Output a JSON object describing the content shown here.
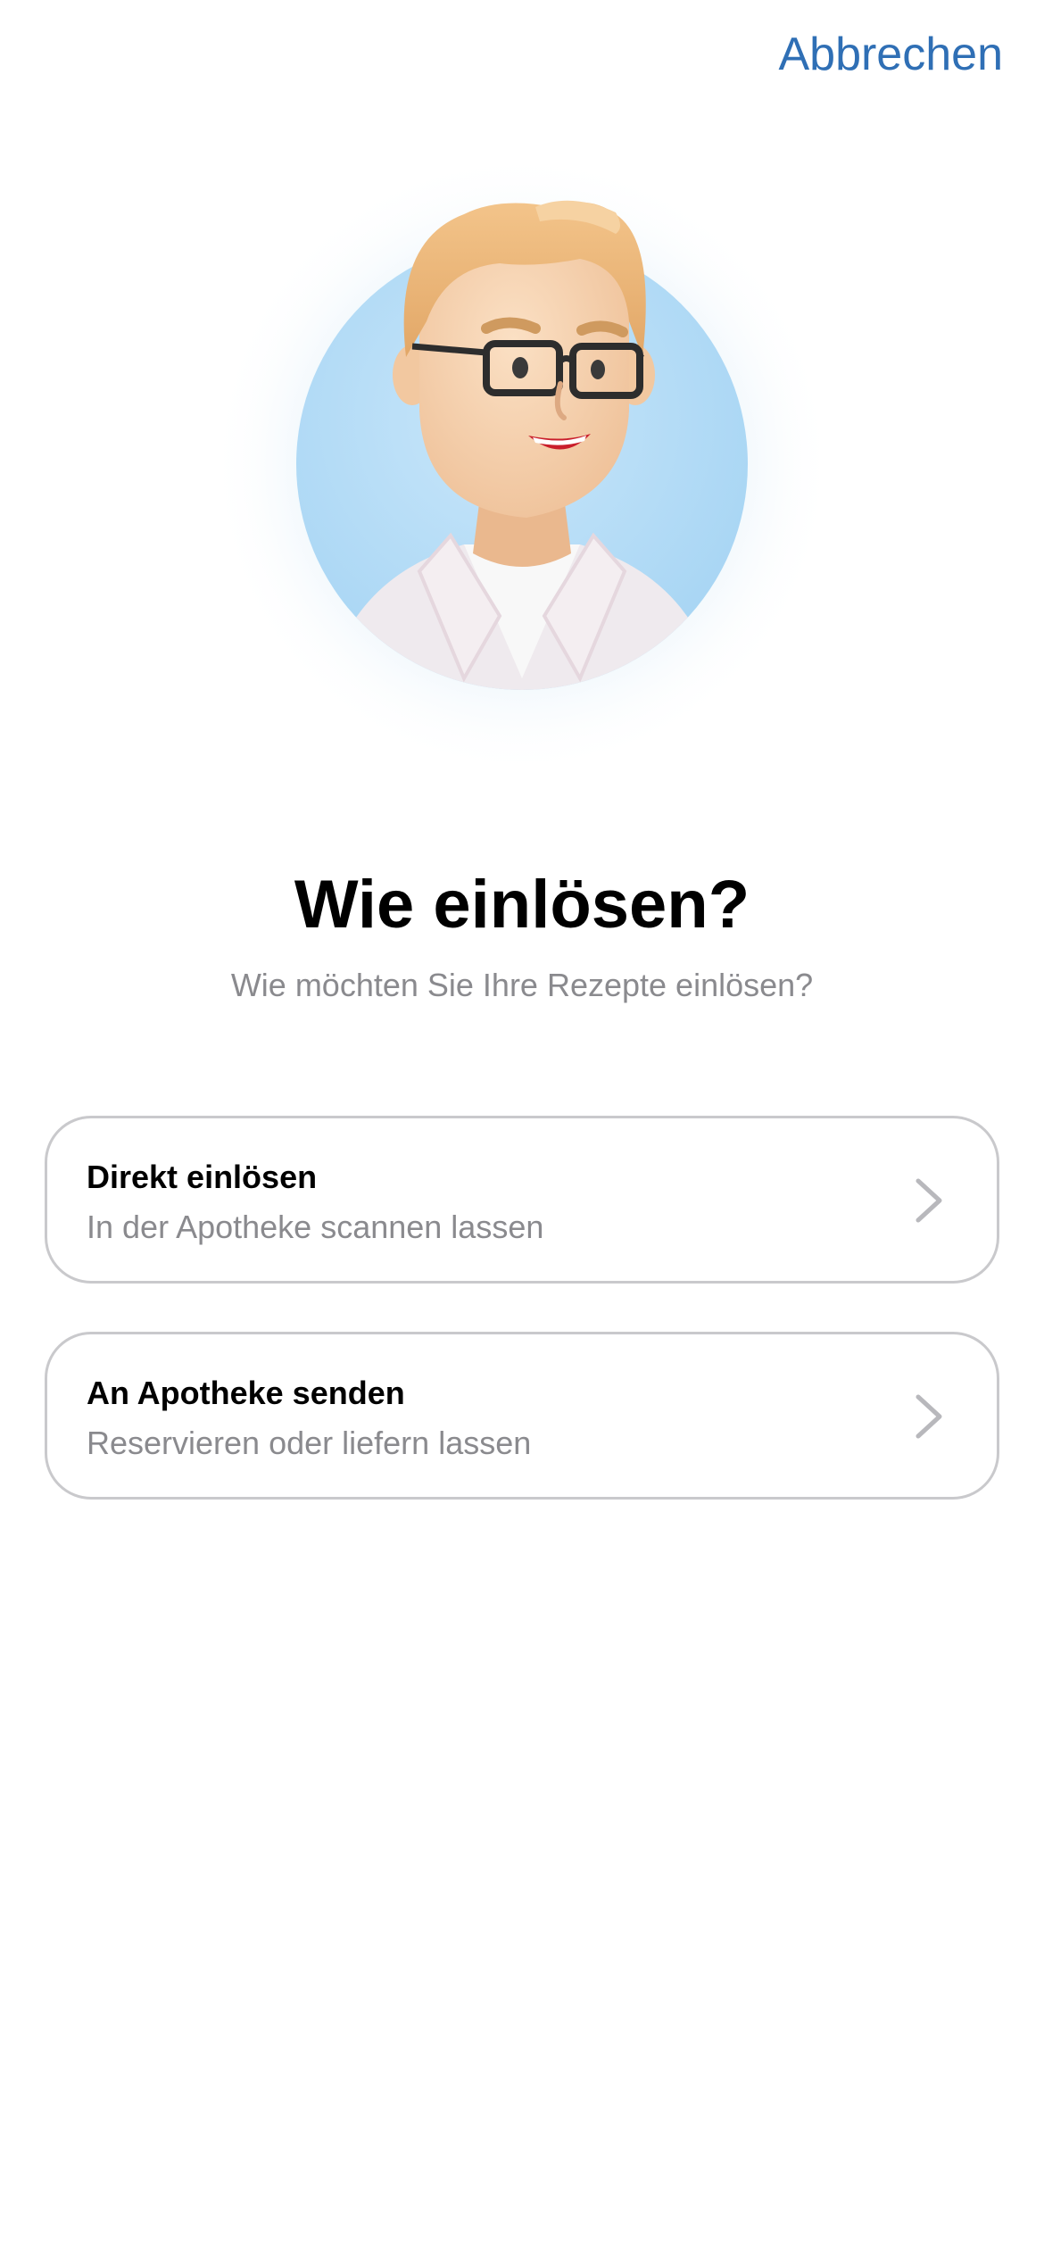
{
  "header": {
    "cancel_label": "Abbrechen"
  },
  "hero": {
    "illustration": "pharmacist-avatar",
    "accent_color": "#bfe0f7"
  },
  "main": {
    "title": "Wie einlösen?",
    "subtitle": "Wie möchten Sie Ihre Rezepte einlösen?"
  },
  "options": [
    {
      "title": "Direkt einlösen",
      "subtitle": "In der Apotheke scannen lassen",
      "icon": "chevron-right-icon"
    },
    {
      "title": "An Apotheke senden",
      "subtitle": "Reservieren oder liefern lassen",
      "icon": "chevron-right-icon"
    }
  ],
  "colors": {
    "accent": "#2f6fb5",
    "secondary_text": "#8a8a8e",
    "border": "#c9c9cc"
  }
}
